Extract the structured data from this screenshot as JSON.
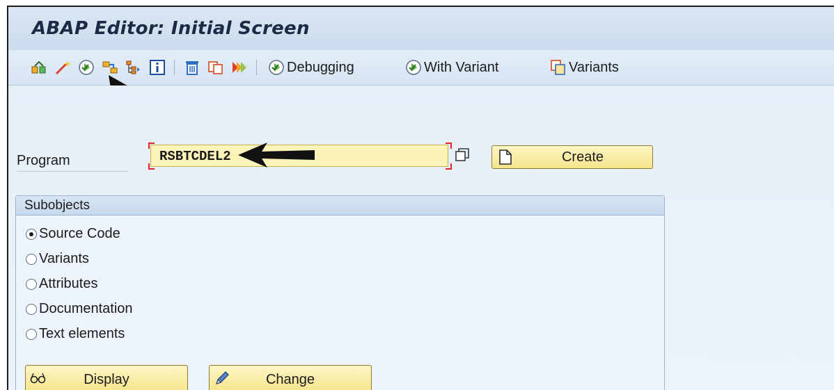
{
  "window": {
    "title": "ABAP Editor: Initial Screen"
  },
  "toolbar": {
    "icons": [
      "other-object-icon",
      "wizard-icon",
      "execute-icon",
      "where-used-icon",
      "hierarchy-icon",
      "info-icon",
      "delete-icon",
      "copy-icon",
      "rename-icon"
    ],
    "debugging_label": "Debugging",
    "with_variant_label": "With Variant",
    "variants_label": "Variants"
  },
  "form": {
    "program_label": "Program",
    "program_value": "RSBTCDEL2",
    "create_label": "Create"
  },
  "subobjects": {
    "title": "Subobjects",
    "options": [
      {
        "label": "Source Code",
        "selected": true
      },
      {
        "label": "Variants",
        "selected": false
      },
      {
        "label": "Attributes",
        "selected": false
      },
      {
        "label": "Documentation",
        "selected": false
      },
      {
        "label": "Text elements",
        "selected": false
      }
    ]
  },
  "actions": {
    "display_label": "Display",
    "change_label": "Change"
  },
  "colors": {
    "title_bg": "#cbdbec",
    "input_bg": "#fbf3b8",
    "button_bg": "#f5e38a",
    "required_marker": "#e0262c"
  }
}
